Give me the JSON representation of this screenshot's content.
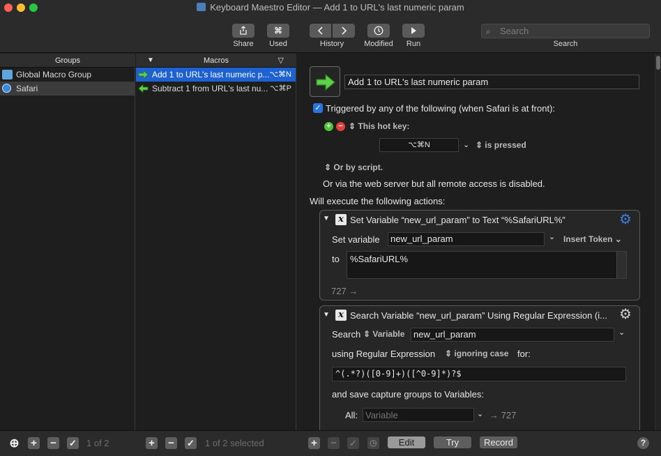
{
  "window": {
    "title": "Keyboard Maestro Editor — Add 1 to URL's last numeric param"
  },
  "toolbar": {
    "share": {
      "label": "Share",
      "icon": "share-icon"
    },
    "used": {
      "label": "Used",
      "icon": "command-icon",
      "glyph": "⌘"
    },
    "history": {
      "label": "History"
    },
    "modified": {
      "label": "Modified",
      "icon": "clock-icon"
    },
    "run": {
      "label": "Run",
      "icon": "play-icon"
    },
    "search": {
      "label": "Search",
      "placeholder": "Search"
    }
  },
  "groups": {
    "header": "Groups",
    "items": [
      {
        "label": "Global Macro Group",
        "icon": "folder-icon"
      },
      {
        "label": "Safari",
        "icon": "safari-icon",
        "selected": true
      }
    ]
  },
  "macros": {
    "header": "Macros",
    "items": [
      {
        "label": "Add 1 to URL's last numeric p...",
        "shortcut": "⌥⌘N",
        "selected": true
      },
      {
        "label": "Subtract 1 from URL's last nu...",
        "shortcut": "⌥⌘P"
      }
    ]
  },
  "editor": {
    "macro_name": "Add 1 to URL's last numeric param",
    "trigger_text": "Triggered by any of the following (when Safari is at front):",
    "hotkey_label": "This hot key:",
    "hotkey_value": "⌥⌘N",
    "hotkey_state": "is pressed",
    "or_script": "Or by script.",
    "web_server": "Or via the web server but all remote access is disabled.",
    "will_execute": "Will execute the following actions:",
    "action1": {
      "title": "Set Variable “new_url_param” to Text “%SafariURL%”",
      "set_variable_label": "Set variable",
      "variable_name": "new_url_param",
      "insert_token": "Insert Token",
      "to_label": "to",
      "to_value": "%SafariURL%",
      "footer": "727 →"
    },
    "action2": {
      "title": "Search Variable “new_url_param” Using Regular Expression (i...",
      "search_label": "Search",
      "variable_label": "Variable",
      "variable_name": "new_url_param",
      "using_label": "using Regular Expression",
      "ignoring_case": "ignoring case",
      "for_label": "for:",
      "regex": "^(.*?)([0-9]+)([^0-9]*)?$",
      "save_label": "and save capture groups to Variables:",
      "all_label": "All:",
      "all_placeholder": "Variable",
      "all_footer": "→ 727"
    }
  },
  "bottom": {
    "groups_count": "1 of 2",
    "macros_count": "1 of 2 selected",
    "edit": "Edit",
    "try": "Try",
    "record": "Record",
    "help": "?"
  },
  "colors": {
    "selection_blue": "#1d62d0",
    "accent_green": "#4fc63a",
    "remove_red": "#e0403c"
  }
}
